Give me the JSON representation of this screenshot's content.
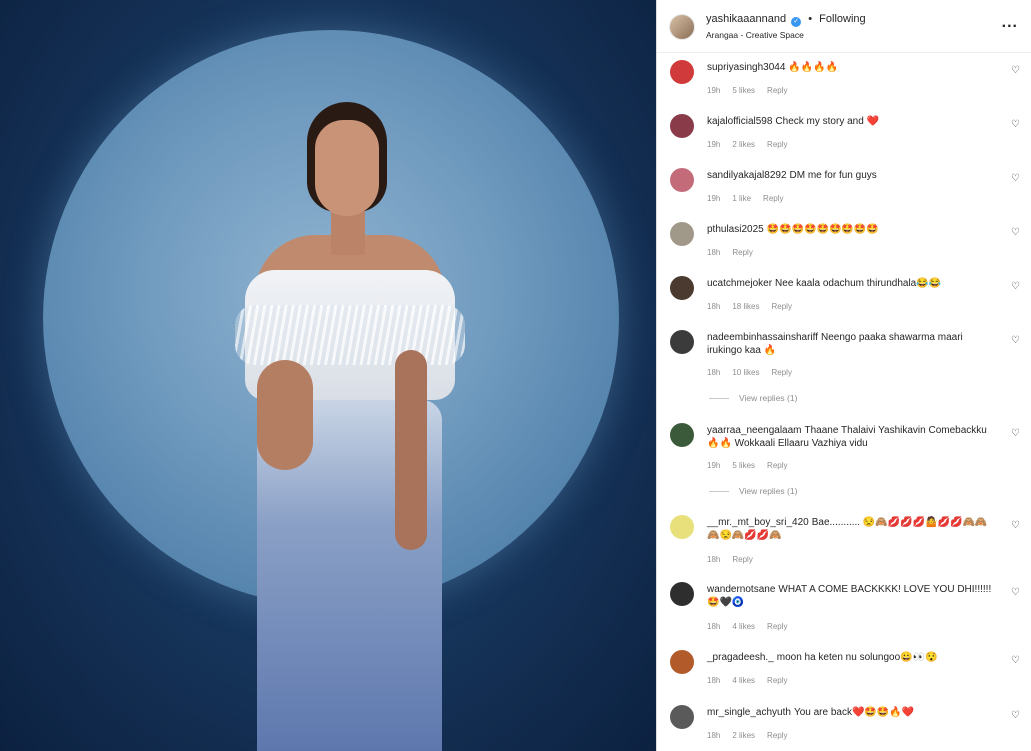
{
  "post": {
    "username": "yashikaaannand",
    "verified_mark": "✓",
    "separator": "•",
    "follow_label": "Following",
    "location": "Arangaa - Creative Space",
    "more_glyph": "..."
  },
  "heart_glyph": "♡",
  "reply_label": "Reply",
  "comments": [
    {
      "user": "supriyasingh3044",
      "text": "🔥🔥🔥🔥",
      "time": "19h",
      "likes": "5 likes",
      "avatar_color": "#d13a3a"
    },
    {
      "user": "kajalofficial598",
      "text": "Check my story and ❤️",
      "time": "19h",
      "likes": "2 likes",
      "avatar_color": "#8a3b4a"
    },
    {
      "user": "sandilyakajal8292",
      "text": "DM me for fun guys",
      "time": "19h",
      "likes": "1 like",
      "avatar_color": "#c46b7a"
    },
    {
      "user": "pthulasi2025",
      "text": "🤩🤩🤩🤩🤩🤩🤩🤩🤩",
      "time": "18h",
      "likes": "",
      "avatar_color": "#a09888"
    },
    {
      "user": "ucatchmejoker",
      "text": "Nee kaala odachum thirundhala😂😂",
      "time": "18h",
      "likes": "18 likes",
      "avatar_color": "#4a3a30"
    },
    {
      "user": "nadeembinhassainshariff",
      "text": "Neengo paaka shawarma maari irukingo kaa 🔥",
      "time": "18h",
      "likes": "10 likes",
      "avatar_color": "#3b3b3b"
    },
    {
      "user": "yaarraa_neengalaam",
      "text": "Thaane Thalaivi Yashikavin Comebackku 🔥🔥 Wokkaali Ellaaru Vazhiya vidu",
      "time": "19h",
      "likes": "5 likes",
      "avatar_color": "#3a5a3a"
    },
    {
      "user": "__mr._mt_boy_sri_420",
      "text": "Bae........... 😒🙈💋💋💋🤷💋💋🙈🙈🙈😒🙈💋💋🙈",
      "time": "18h",
      "likes": "",
      "avatar_color": "#e8e07a"
    },
    {
      "user": "wandernotsane",
      "text": "WHAT A COME BACKKKK! LOVE YOU DHI!!!!!! 🤩🖤🧿",
      "time": "18h",
      "likes": "4 likes",
      "avatar_color": "#2e2e2e"
    },
    {
      "user": "_pragadeesh._",
      "text": "moon ha keten nu solungoo😀👀😯",
      "time": "18h",
      "likes": "4 likes",
      "avatar_color": "#b35a2a"
    },
    {
      "user": "mr_single_achyuth",
      "text": "You are back❤️🤩🤩🔥❤️",
      "time": "18h",
      "likes": "2 likes",
      "avatar_color": "#5a5a5a"
    }
  ],
  "view_replies": [
    "View replies (1)",
    "View replies (1)"
  ]
}
